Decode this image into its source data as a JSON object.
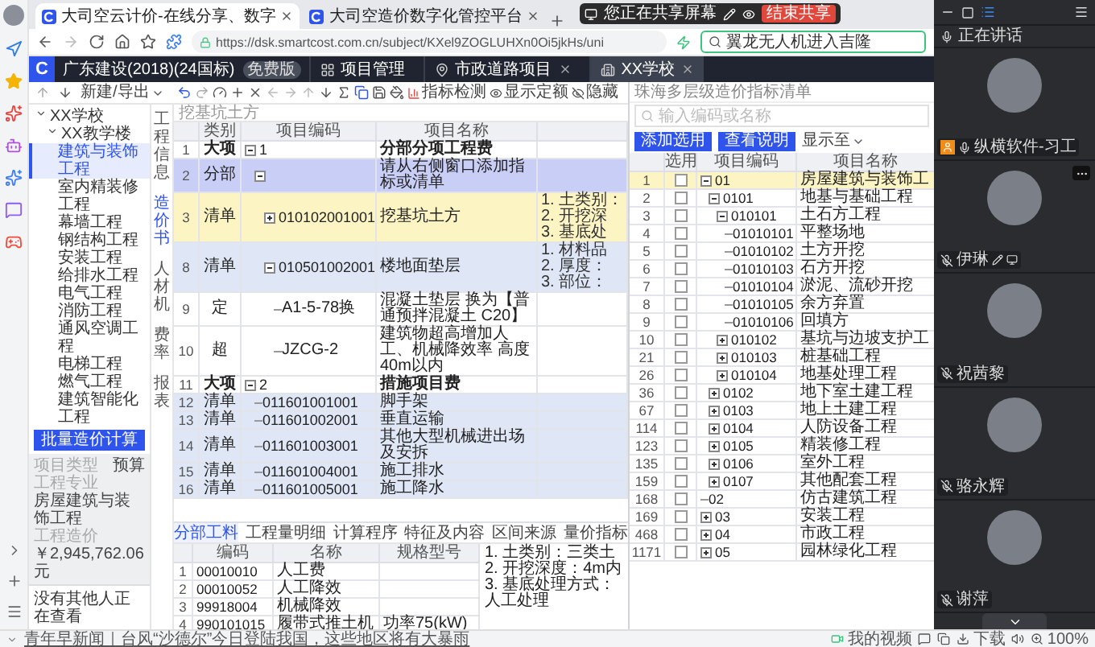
{
  "browser": {
    "tabs": [
      {
        "title": "大司空云计价-在线分享、数字",
        "selected": true
      },
      {
        "title": "大司空造价数字化管控平台",
        "selected": false
      }
    ],
    "url": "https://dsk.smartcost.com.cn/subject/KXel9ZOGLUHXn0Oi5jkHs/uni",
    "search": {
      "value": "翼龙无人机进入吉隆"
    }
  },
  "share_bar": {
    "label": "您正在共享屏幕",
    "stop_button": "结束共享"
  },
  "app": {
    "logo": "C",
    "product": "广东建设(2018)(24国标)",
    "badge": "免费版",
    "tabs": [
      {
        "label": "项目管理",
        "kind": "manager",
        "selected": false
      },
      {
        "label": "市政道路项目",
        "kind": "project",
        "selected": false
      },
      {
        "label": "XX学校",
        "kind": "unit",
        "selected": true
      }
    ]
  },
  "toolbar": {
    "new_export": "新建/导出",
    "buttons": [
      {
        "label": "指标检测",
        "kind": "check"
      },
      {
        "label": "显示定额",
        "kind": "show"
      },
      {
        "label": "隐藏",
        "kind": "hide"
      }
    ]
  },
  "project_tree": {
    "items": [
      {
        "label": "XX学校",
        "selected": false,
        "expanded": true,
        "children": [
          {
            "label": "XX教学楼",
            "selected": false,
            "expanded": true,
            "children": [
              {
                "label": "建筑与装饰工程",
                "selected": true
              },
              {
                "label": "室内精装修工程",
                "selected": false
              },
              {
                "label": "幕墙工程",
                "selected": false
              },
              {
                "label": "钢结构工程",
                "selected": false
              },
              {
                "label": "安装工程",
                "selected": false
              },
              {
                "label": "给排水工程",
                "selected": false
              },
              {
                "label": "电气工程",
                "selected": false
              },
              {
                "label": "消防工程",
                "selected": false
              },
              {
                "label": "通风空调工程",
                "selected": false
              },
              {
                "label": "电梯工程",
                "selected": false
              },
              {
                "label": "燃气工程",
                "selected": false
              },
              {
                "label": "建筑智能化工程",
                "selected": false
              }
            ]
          }
        ]
      }
    ],
    "batch_button": "批量造价计算",
    "fields": [
      {
        "label": "项目类型",
        "value": "预算"
      },
      {
        "label": "工程专业",
        "value": "房屋建筑与装饰工程"
      },
      {
        "label": "工程造价",
        "value": "￥2,945,762.06元"
      }
    ],
    "viewers": "没有其他人正在查看"
  },
  "side_tabs": [
    {
      "label": "工程信息",
      "selected": false
    },
    {
      "label": "造价书",
      "selected": true
    },
    {
      "label": "人材机",
      "selected": false
    },
    {
      "label": "费率",
      "selected": false
    },
    {
      "label": "报表",
      "selected": false
    }
  ],
  "bill_table": {
    "filter": "挖基坑土方",
    "columns": [
      "类别",
      "项目编码",
      "项目名称"
    ],
    "rows": [
      {
        "index": "1",
        "category": "大项",
        "kind": "heading",
        "code": "1",
        "name": "分部分项工程费",
        "selected": false,
        "expanded": true,
        "children": [
          {
            "index": "2",
            "category": "分部",
            "kind": "section",
            "name": "请从右侧窗口添加指标或清单",
            "selected": false,
            "expanded": true,
            "children": [
              {
                "index": "3",
                "category": "清单",
                "kind": "bill",
                "code": "010102001001",
                "name": "挖基坑土方",
                "features": [
                  "1. 土类别：",
                  "2. 开挖深",
                  "3. 基底处"
                ],
                "selected": true,
                "expanded": false
              },
              {
                "index": "8",
                "category": "清单",
                "kind": "bill",
                "code": "010501002001",
                "name": "楼地面垫层",
                "features": [
                  "1. 材料品",
                  "2. 厚度：",
                  "3. 部位："
                ],
                "selected": false,
                "expanded": true,
                "children": [
                  {
                    "index": "9",
                    "category": "定",
                    "kind": "quota",
                    "code": "A1-5-78换",
                    "name": "混凝土垫层 换为【普通预拌混凝土 C20】",
                    "selected": false
                  },
                  {
                    "index": "10",
                    "category": "超",
                    "kind": "quota",
                    "code": "JZCG-2",
                    "name": "建筑物超高增加人工、机械降效率 高度 40m以内",
                    "selected": false
                  }
                ]
              }
            ]
          }
        ]
      },
      {
        "index": "11",
        "category": "大项",
        "kind": "heading",
        "code": "2",
        "name": "措施项目费",
        "selected": false,
        "expanded": true,
        "children": [
          {
            "index": "12",
            "category": "清单",
            "kind": "bill",
            "code": "011601001001",
            "name": "脚手架",
            "selected": false
          },
          {
            "index": "13",
            "category": "清单",
            "kind": "bill",
            "code": "011601002001",
            "name": "垂直运输",
            "selected": false
          },
          {
            "index": "14",
            "category": "清单",
            "kind": "bill",
            "code": "011601003001",
            "name": "其他大型机械进出场及安拆",
            "selected": false
          },
          {
            "index": "15",
            "category": "清单",
            "kind": "bill",
            "code": "011601004001",
            "name": "施工排水",
            "selected": false
          },
          {
            "index": "16",
            "category": "清单",
            "kind": "bill",
            "code": "011601005001",
            "name": "施工降水",
            "selected": false
          }
        ]
      }
    ]
  },
  "detail_panel": {
    "tabs": [
      {
        "label": "分部工料",
        "selected": true
      },
      {
        "label": "工程量明细",
        "selected": false
      },
      {
        "label": "计算程序",
        "selected": false
      },
      {
        "label": "特征及内容",
        "selected": false
      },
      {
        "label": "区间来源",
        "selected": false
      },
      {
        "label": "量价指标",
        "selected": false
      }
    ],
    "columns": [
      "编码",
      "名称",
      "规格型号"
    ],
    "rows": [
      {
        "index": "1",
        "code": "00010010",
        "name": "人工费"
      },
      {
        "index": "2",
        "code": "00010052",
        "name": "人工降效"
      },
      {
        "index": "3",
        "code": "99918004",
        "name": "机械降效"
      },
      {
        "index": "4",
        "code": "990101015",
        "name": "履带式推土机",
        "spec": "功率75(kW)"
      }
    ],
    "description": [
      "1. 土类别：三类土",
      "2. 开挖深度：4m内",
      "3. 基底处理方式：人工处理"
    ]
  },
  "index_panel": {
    "title": "珠海多层级造价指标清单",
    "search": {
      "placeholder": "输入编码或名称"
    },
    "buttons": [
      "添加选用",
      "查看说明"
    ],
    "display_menu": "显示至",
    "columns": [
      "选用",
      "项目编码",
      "项目名称"
    ],
    "rows": [
      {
        "index": "1",
        "code": "01",
        "name": "房屋建筑与装饰工",
        "checked": false,
        "selected": true,
        "expanded": true,
        "children": [
          {
            "index": "2",
            "code": "0101",
            "name": "地基与基础工程",
            "checked": false,
            "selected": false,
            "expanded": true,
            "children": [
              {
                "index": "3",
                "code": "010101",
                "name": "土石方工程",
                "checked": false,
                "selected": false,
                "expanded": true,
                "children": [
                  {
                    "index": "4",
                    "code": "01010101",
                    "name": "平整场地",
                    "checked": false,
                    "selected": false
                  },
                  {
                    "index": "5",
                    "code": "01010102",
                    "name": "土方开挖",
                    "checked": false,
                    "selected": false
                  },
                  {
                    "index": "6",
                    "code": "01010103",
                    "name": "石方开挖",
                    "checked": false,
                    "selected": false
                  },
                  {
                    "index": "7",
                    "code": "01010104",
                    "name": "淤泥、流砂开挖",
                    "checked": false,
                    "selected": false
                  },
                  {
                    "index": "8",
                    "code": "01010105",
                    "name": "余方弃置",
                    "checked": false,
                    "selected": false
                  },
                  {
                    "index": "9",
                    "code": "01010106",
                    "name": "回填方",
                    "checked": false,
                    "selected": false
                  }
                ]
              },
              {
                "index": "10",
                "code": "010102",
                "name": "基坑与边坡支护工",
                "checked": false,
                "selected": false,
                "expanded": false
              },
              {
                "index": "21",
                "code": "010103",
                "name": "桩基础工程",
                "checked": false,
                "selected": false,
                "expanded": false
              },
              {
                "index": "26",
                "code": "010104",
                "name": "地基处理工程",
                "checked": false,
                "selected": false,
                "expanded": false
              }
            ]
          },
          {
            "index": "36",
            "code": "0102",
            "name": "地下室土建工程",
            "checked": false,
            "selected": false,
            "expanded": false
          },
          {
            "index": "67",
            "code": "0103",
            "name": "地上土建工程",
            "checked": false,
            "selected": false,
            "expanded": false
          },
          {
            "index": "114",
            "code": "0104",
            "name": "人防设备工程",
            "checked": false,
            "selected": false,
            "expanded": false
          },
          {
            "index": "123",
            "code": "0105",
            "name": "精装修工程",
            "checked": false,
            "selected": false,
            "expanded": false
          },
          {
            "index": "135",
            "code": "0106",
            "name": "室外工程",
            "checked": false,
            "selected": false,
            "expanded": false
          },
          {
            "index": "159",
            "code": "0107",
            "name": "其他配套工程",
            "checked": false,
            "selected": false,
            "expanded": false
          }
        ]
      },
      {
        "index": "168",
        "code": "02",
        "name": "仿古建筑工程",
        "checked": false,
        "selected": false
      },
      {
        "index": "169",
        "code": "03",
        "name": "安装工程",
        "checked": false,
        "selected": false,
        "expanded": false
      },
      {
        "index": "468",
        "code": "04",
        "name": "市政工程",
        "checked": false,
        "selected": false,
        "expanded": false
      },
      {
        "index": "1171",
        "code": "05",
        "name": "园林绿化工程",
        "checked": false,
        "selected": false,
        "expanded": false
      }
    ]
  },
  "video_panel": {
    "speaking_label": "正在讲话",
    "participants": [
      {
        "name": "纵横软件-习工",
        "kind": "host",
        "muted": false
      },
      {
        "name": "伊琳",
        "kind": "presenter",
        "muted": true
      },
      {
        "name": "祝茜黎",
        "kind": "guest",
        "muted": true
      },
      {
        "name": "骆永辉",
        "kind": "guest",
        "muted": true
      },
      {
        "name": "谢萍",
        "kind": "guest",
        "muted": true
      }
    ]
  },
  "status_bar": {
    "news": "青年早新闻｜台风“沙德尔”今日登陆我国，这些地区将有大暴雨",
    "video_button": "我的视频",
    "download": "下载",
    "zoom": "100%"
  }
}
